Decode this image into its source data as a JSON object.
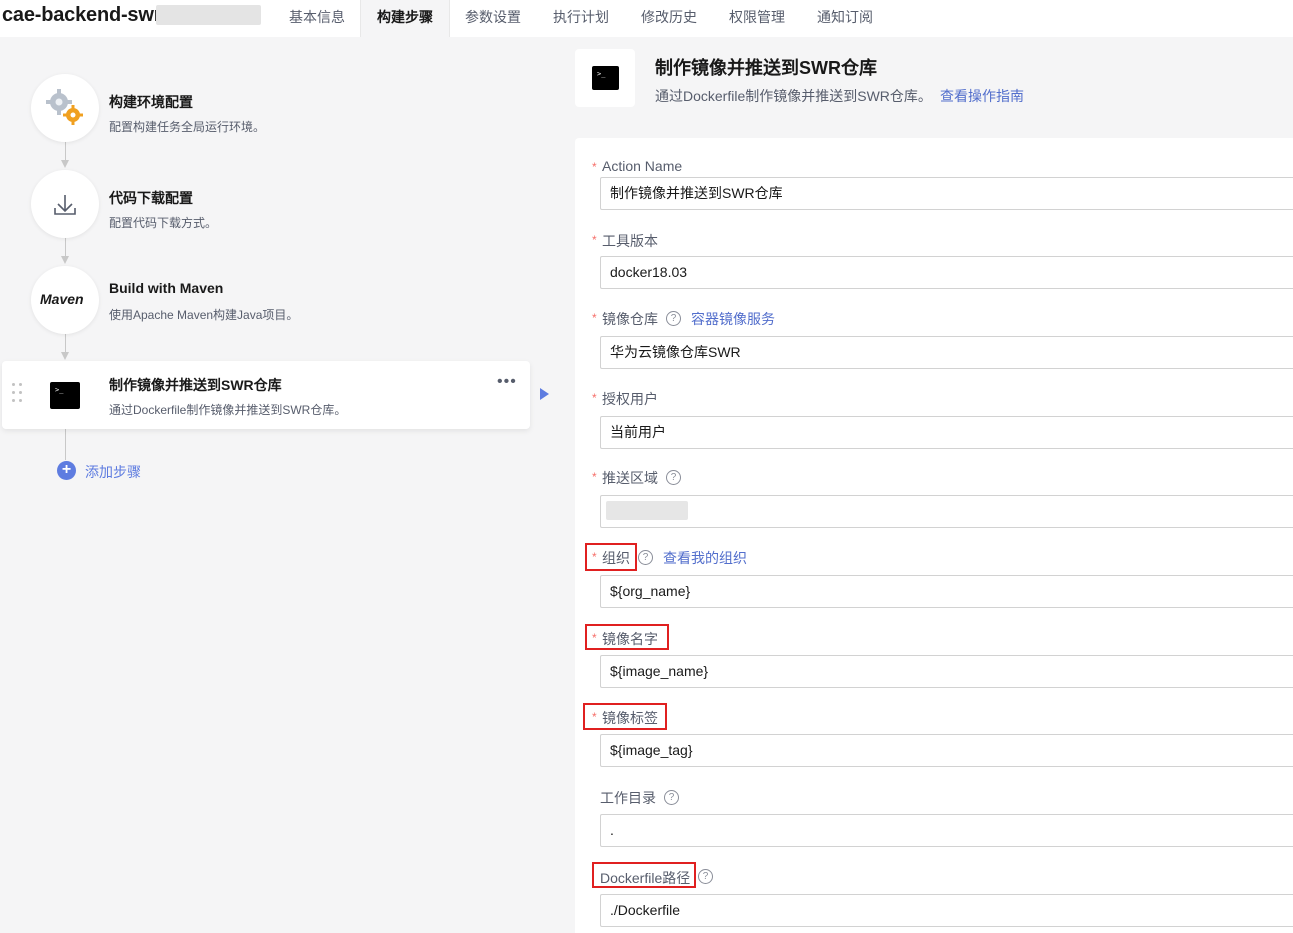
{
  "app": {
    "title": "cae-backend-swr-"
  },
  "tabs": [
    {
      "label": "基本信息",
      "active": false
    },
    {
      "label": "构建步骤",
      "active": true
    },
    {
      "label": "参数设置",
      "active": false
    },
    {
      "label": "执行计划",
      "active": false
    },
    {
      "label": "修改历史",
      "active": false
    },
    {
      "label": "权限管理",
      "active": false
    },
    {
      "label": "通知订阅",
      "active": false
    }
  ],
  "steps": [
    {
      "title": "构建环境配置",
      "desc": "配置构建任务全局运行环境。",
      "icon": "gears-icon"
    },
    {
      "title": "代码下载配置",
      "desc": "配置代码下载方式。",
      "icon": "download-icon"
    },
    {
      "title": "Build with Maven",
      "desc": "使用Apache Maven构建Java项目。",
      "icon": "maven-logo",
      "logo_text": "Maven"
    },
    {
      "title": "制作镜像并推送到SWR仓库",
      "desc": "通过Dockerfile制作镜像并推送到SWR仓库。",
      "icon": "terminal-icon",
      "active": true
    }
  ],
  "add_step_label": "添加步骤",
  "detail": {
    "title": "制作镜像并推送到SWR仓库",
    "desc": "通过Dockerfile制作镜像并推送到SWR仓库。",
    "guide_link": "查看操作指南",
    "terminal_glyph": ">_"
  },
  "form": {
    "required_mark": "*",
    "help_glyph": "?",
    "action_name": {
      "label": "Action Name",
      "value": "制作镜像并推送到SWR仓库"
    },
    "tool_version": {
      "label": "工具版本",
      "value": "docker18.03"
    },
    "registry": {
      "label": "镜像仓库",
      "link": "容器镜像服务",
      "value": "华为云镜像仓库SWR"
    },
    "auth_user": {
      "label": "授权用户",
      "value": "当前用户"
    },
    "push_region": {
      "label": "推送区域"
    },
    "organization": {
      "label": "组织",
      "link": "查看我的组织",
      "value": "${org_name}"
    },
    "image_name": {
      "label": "镜像名字",
      "value": "${image_name}"
    },
    "image_tag": {
      "label": "镜像标签",
      "value": "${image_tag}"
    },
    "work_dir": {
      "label": "工作目录",
      "value": "."
    },
    "dockerfile_path": {
      "label": "Dockerfile路径",
      "value": "./Dockerfile"
    }
  },
  "colors": {
    "accent": "#5e7ce0",
    "link": "#526ecc",
    "required": "#f66f6a",
    "highlight_box": "#e02020"
  }
}
